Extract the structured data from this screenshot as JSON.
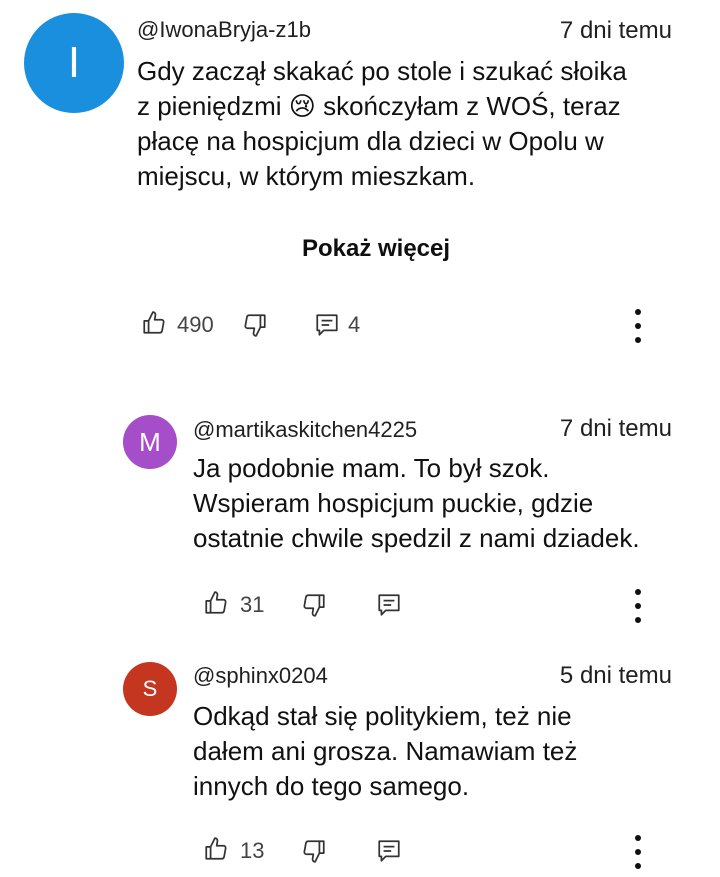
{
  "comments": [
    {
      "avatar_letter": "I",
      "avatar_color": "#1a8fde",
      "author": "@IwonaBryja-z1b",
      "time": "7 dni temu",
      "lines": [
        "Gdy zaczął skakać po stole i szukać słoika",
        "z pieniędzmi 😢 skończyłam z WOŚ, teraz",
        "płacę na hospicjum dla dzieci w Opolu w",
        "miejscu, w którym mieszkam."
      ],
      "show_more": "Pokaż więcej",
      "likes": "490",
      "replies": "4"
    },
    {
      "avatar_letter": "M",
      "avatar_color": "#a64dc9",
      "author": "@martikaskitchen4225",
      "time": "7 dni temu",
      "lines": [
        "Ja podobnie mam. To był szok.",
        "Wspieram hospicjum puckie, gdzie",
        "ostatnie chwile spedzil z nami dziadek."
      ],
      "likes": "31"
    },
    {
      "avatar_letter": "S",
      "avatar_color": "#c4361f",
      "author": "@sphinx0204",
      "time": "5 dni temu",
      "lines": [
        "Odkąd stał się politykiem, też nie",
        "dałem ani grosza. Namawiam też",
        "innych do tego samego."
      ],
      "likes": "13"
    }
  ],
  "icons": {
    "like": "thumbs-up-icon",
    "dislike": "thumbs-down-icon",
    "reply": "comment-icon",
    "menu": "more-vert-icon"
  }
}
